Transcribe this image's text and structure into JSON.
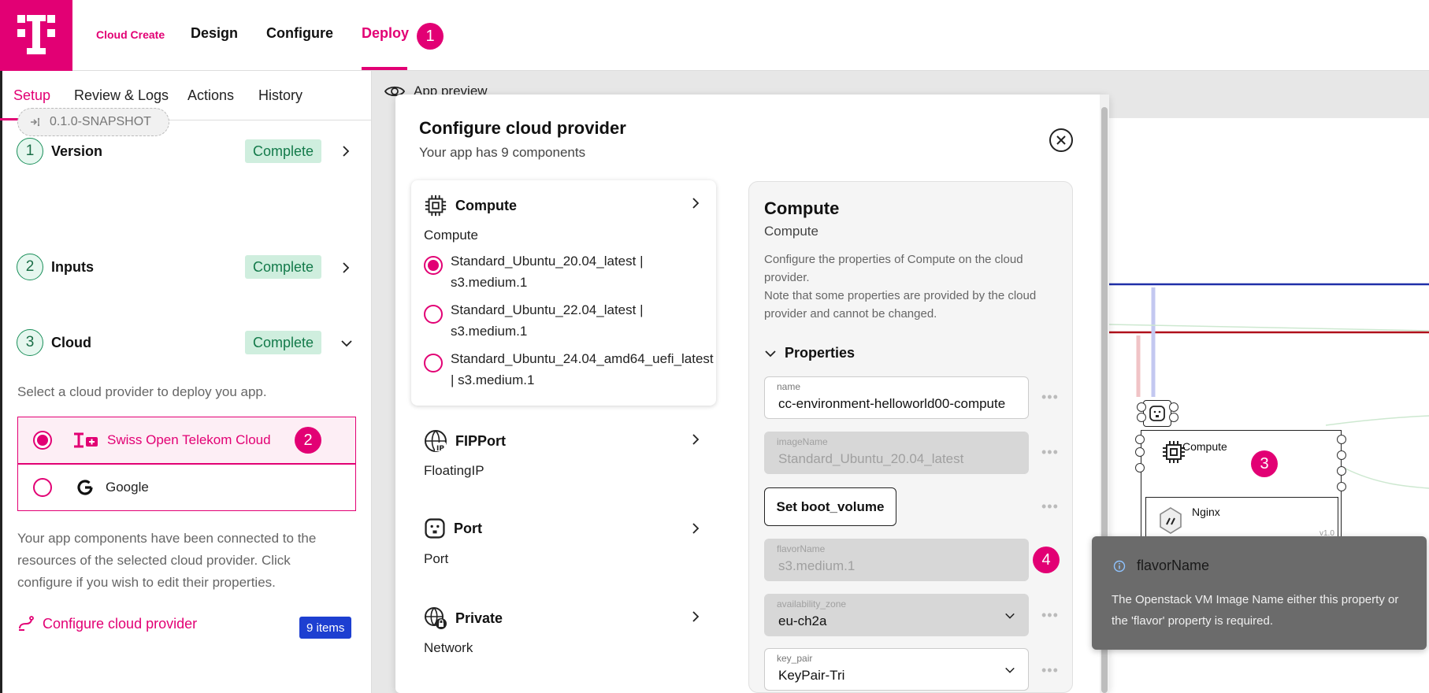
{
  "app": {
    "brand": "Cloud Create",
    "nav": [
      "Design",
      "Configure",
      "Deploy"
    ],
    "active_nav": "Deploy",
    "deploy_badge": "1"
  },
  "left": {
    "tabs": [
      "Setup",
      "Review & Logs",
      "Actions",
      "History"
    ],
    "steps": [
      {
        "num": "1",
        "title": "Version",
        "status": "Complete"
      },
      {
        "num": "2",
        "title": "Inputs",
        "status": "Complete"
      },
      {
        "num": "3",
        "title": "Cloud",
        "status": "Complete"
      }
    ],
    "version_chip": "0.1.0-SNAPSHOT",
    "cloud_prompt": "Select a cloud provider to deploy you app.",
    "providers": [
      {
        "name": "Swiss Open Telekom Cloud",
        "selected": true,
        "badge": "2"
      },
      {
        "name": "Google",
        "selected": false
      }
    ],
    "info_lines": [
      "Your app components have been connected to the",
      "resources of the selected cloud provider. Click",
      "configure if you wish to edit their properties."
    ],
    "configure_link": "Configure cloud provider",
    "items_badge": "9 items"
  },
  "canvas": {
    "preview_label": "App preview",
    "nodes": [
      {
        "label": "Compute",
        "badge": "3"
      },
      {
        "label": "Nginx",
        "version": "v1.0"
      }
    ]
  },
  "modal": {
    "title": "Configure cloud provider",
    "subtitle": "Your app has 9 components",
    "components": [
      {
        "title": "Compute",
        "subtitle": "Compute",
        "icon": "chip-icon"
      },
      {
        "title": "FIPPort",
        "subtitle": "FloatingIP",
        "icon": "floating-ip-icon"
      },
      {
        "title": "Port",
        "subtitle": "Port",
        "icon": "port-icon"
      },
      {
        "title": "Private",
        "subtitle": "Network",
        "icon": "network-icon"
      }
    ],
    "compute_options": [
      {
        "line1": "Standard_Ubuntu_20.04_latest |",
        "line2": "s3.medium.1",
        "selected": true
      },
      {
        "line1": "Standard_Ubuntu_22.04_latest |",
        "line2": "s3.medium.1",
        "selected": false
      },
      {
        "line1": "Standard_Ubuntu_24.04_amd64_uefi_latest",
        "line2": "| s3.medium.1",
        "selected": false
      }
    ],
    "detail": {
      "title": "Compute",
      "subtitle": "Compute",
      "desc1_lines": [
        "Configure the properties of Compute on the cloud",
        "provider."
      ],
      "desc2_lines": [
        "Note that some properties are provided by the cloud",
        "provider and cannot be changed."
      ],
      "properties_label": "Properties",
      "fields": [
        {
          "label": "name",
          "value": "cc-environment-helloworld00-compute",
          "disabled": false
        },
        {
          "label": "imageName",
          "value": "Standard_Ubuntu_20.04_latest",
          "disabled": true
        },
        {
          "label": "flavorName",
          "value": "s3.medium.1",
          "disabled": true,
          "badge": "4"
        },
        {
          "label": "availability_zone",
          "value": "eu-ch2a",
          "disabled": true
        },
        {
          "label": "key_pair",
          "value": "KeyPair-Tri",
          "disabled": false
        }
      ],
      "boot_button": "Set boot_volume"
    }
  },
  "tooltip": {
    "title": "flavorName",
    "text_lines": [
      "The Openstack VM Image Name either this property or",
      "the 'flavor' property is required."
    ]
  },
  "colors": {
    "accent": "#e20074",
    "success_bg": "#cfeede",
    "success_text": "#137a4a",
    "info_badge": "#1d3fd1"
  }
}
